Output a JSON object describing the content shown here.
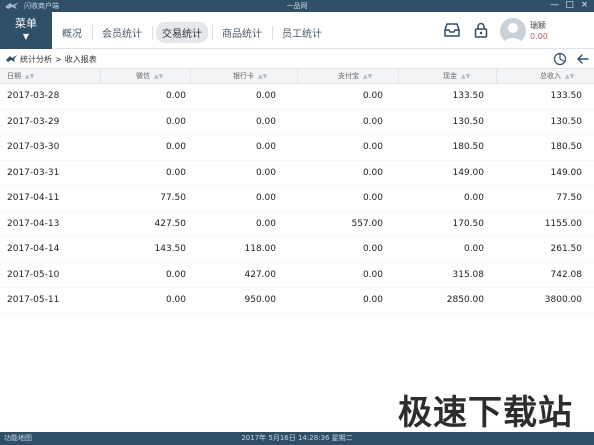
{
  "window": {
    "app_name": "闪收商户端",
    "title": "一品网",
    "minimize": "—",
    "maximize": "□",
    "close": "×"
  },
  "header": {
    "menu_label": "菜单",
    "menu_caret": "▼",
    "tabs": [
      {
        "label": "概况",
        "active": false
      },
      {
        "label": "会员统计",
        "active": false
      },
      {
        "label": "交易统计",
        "active": true
      },
      {
        "label": "商品统计",
        "active": false
      },
      {
        "label": "员工统计",
        "active": false
      }
    ],
    "user": {
      "name": "瑞颖",
      "balance": "0.00"
    },
    "icons": [
      "inbox-icon",
      "lock-icon",
      "user-avatar"
    ]
  },
  "breadcrumb": {
    "parent": "统计分析",
    "separator": ">",
    "current": "收入报表"
  },
  "table": {
    "columns": [
      "日期",
      "微信",
      "银行卡",
      "支付宝",
      "现金",
      "总收入"
    ],
    "rows": [
      [
        "2017-03-28",
        "0.00",
        "0.00",
        "0.00",
        "133.50",
        "133.50"
      ],
      [
        "2017-03-29",
        "0.00",
        "0.00",
        "0.00",
        "130.50",
        "130.50"
      ],
      [
        "2017-03-30",
        "0.00",
        "0.00",
        "0.00",
        "180.50",
        "180.50"
      ],
      [
        "2017-03-31",
        "0.00",
        "0.00",
        "0.00",
        "149.00",
        "149.00"
      ],
      [
        "2017-04-11",
        "77.50",
        "0.00",
        "0.00",
        "0.00",
        "77.50"
      ],
      [
        "2017-04-13",
        "427.50",
        "0.00",
        "557.00",
        "170.50",
        "1155.00"
      ],
      [
        "2017-04-14",
        "143.50",
        "118.00",
        "0.00",
        "0.00",
        "261.50"
      ],
      [
        "2017-05-10",
        "0.00",
        "427.00",
        "0.00",
        "315.08",
        "742.08"
      ],
      [
        "2017-05-11",
        "0.00",
        "950.00",
        "0.00",
        "2850.00",
        "3800.00"
      ]
    ]
  },
  "watermark": "极速下载站",
  "statusbar": {
    "left": "功能地图",
    "center": "2017年 5月16日 14:28:36 星期二"
  },
  "colors": {
    "chrome": "#2f4e68",
    "accent_red": "#e05252",
    "tab_active_bg": "#e4e8ec"
  }
}
